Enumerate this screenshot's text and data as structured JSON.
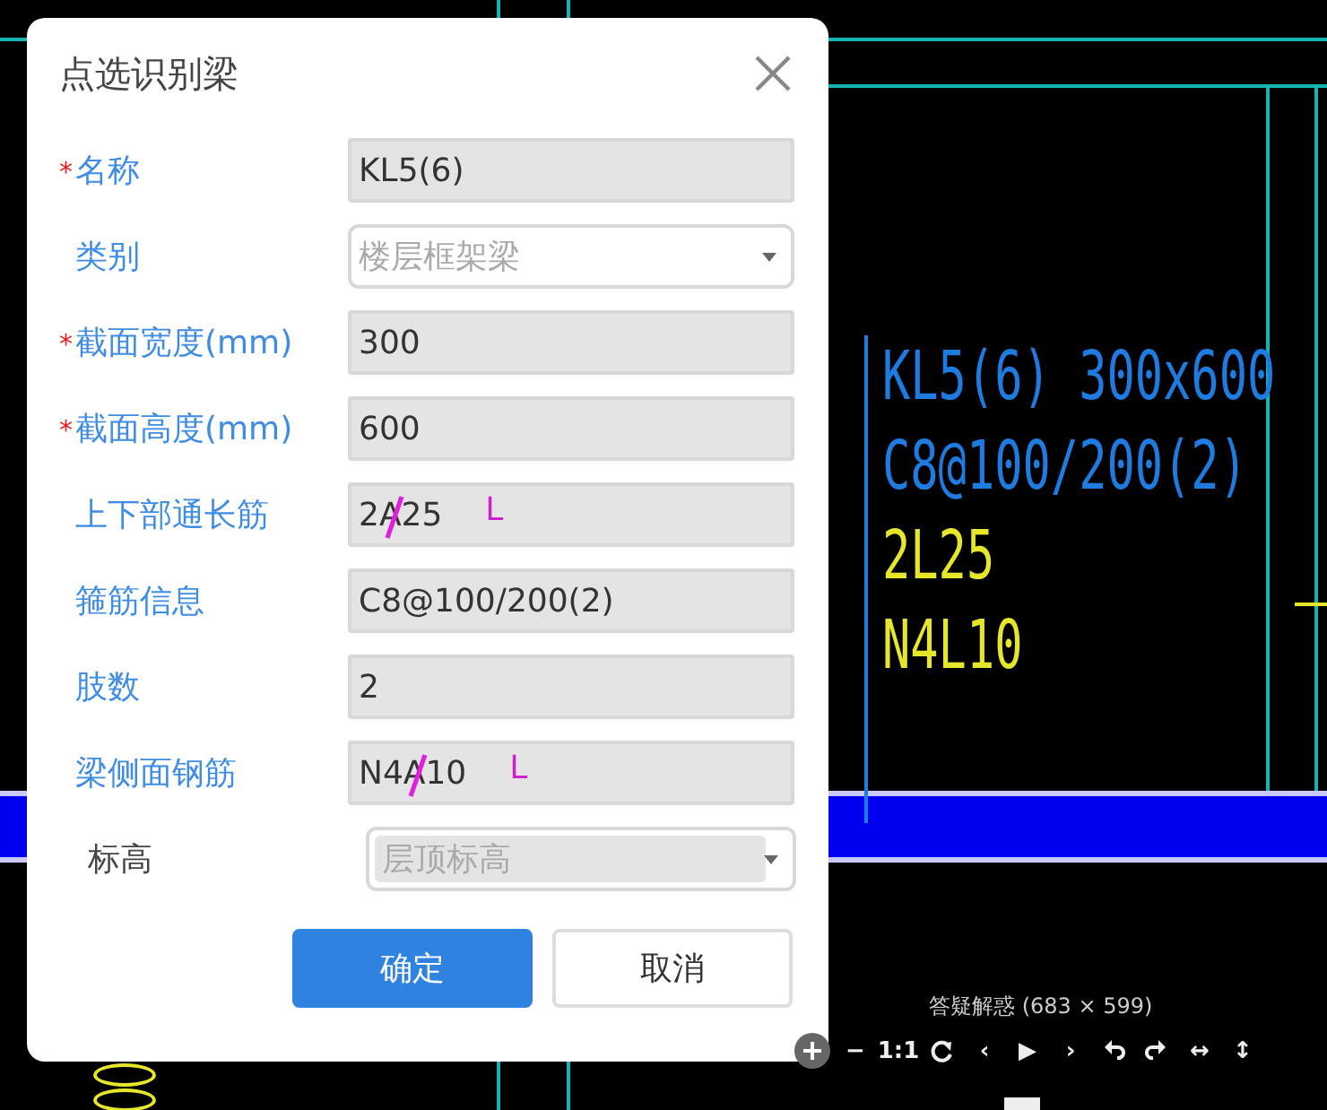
{
  "cad": {
    "labels": [
      {
        "text": "KL5(6) 300x600",
        "color": "#1e7be0"
      },
      {
        "text": "C8@100/200(2)",
        "color": "#1e7be0"
      },
      {
        "text": "2L25",
        "color": "#e6e62a"
      },
      {
        "text": "N4L10",
        "color": "#e6e62a"
      }
    ]
  },
  "dialog": {
    "title": "点选识别梁",
    "fields": [
      {
        "label": "名称",
        "required_mark": "*",
        "accent": true,
        "kind": "text",
        "disabled": false,
        "value": "KL5(6)"
      },
      {
        "label": "类别",
        "accent": true,
        "kind": "select",
        "disabled": true,
        "value": "楼层框架梁"
      },
      {
        "label": "截面宽度(mm)",
        "required_mark": "*",
        "accent": true,
        "kind": "text",
        "disabled": false,
        "value": "300"
      },
      {
        "label": "截面高度(mm)",
        "required_mark": "*",
        "accent": true,
        "kind": "text",
        "disabled": false,
        "value": "600"
      },
      {
        "label": "上下部通长筋",
        "accent": true,
        "kind": "text",
        "disabled": false,
        "value": "2A25",
        "struck": true,
        "note": "L"
      },
      {
        "label": "箍筋信息",
        "accent": true,
        "kind": "text",
        "disabled": false,
        "value": "C8@100/200(2)"
      },
      {
        "label": "肢数",
        "accent": true,
        "kind": "text",
        "disabled": false,
        "value": "2"
      },
      {
        "label": "梁侧面钢筋",
        "accent": true,
        "kind": "text",
        "disabled": false,
        "value": "N4A10",
        "struck": true,
        "note": "L"
      },
      {
        "label": "标高",
        "accent": false,
        "kind": "combo",
        "disabled": true,
        "value": "层顶标高"
      }
    ],
    "buttons": [
      {
        "label": "确定",
        "kind": "primary"
      },
      {
        "label": "取消",
        "kind": "secondary"
      }
    ]
  },
  "viewer": {
    "caption": "答疑解惑 (683 × 599)",
    "tools": [
      {
        "kind": "zoom-in"
      },
      {
        "kind": "text",
        "label": "−"
      },
      {
        "kind": "text",
        "label": "1:1"
      },
      {
        "kind": "rotate"
      },
      {
        "kind": "text",
        "label": "‹"
      },
      {
        "kind": "text",
        "label": "▶"
      },
      {
        "kind": "text",
        "label": "›"
      },
      {
        "kind": "undo"
      },
      {
        "kind": "redo"
      },
      {
        "kind": "text",
        "label": "↔"
      },
      {
        "kind": "text",
        "label": "↕"
      }
    ]
  }
}
